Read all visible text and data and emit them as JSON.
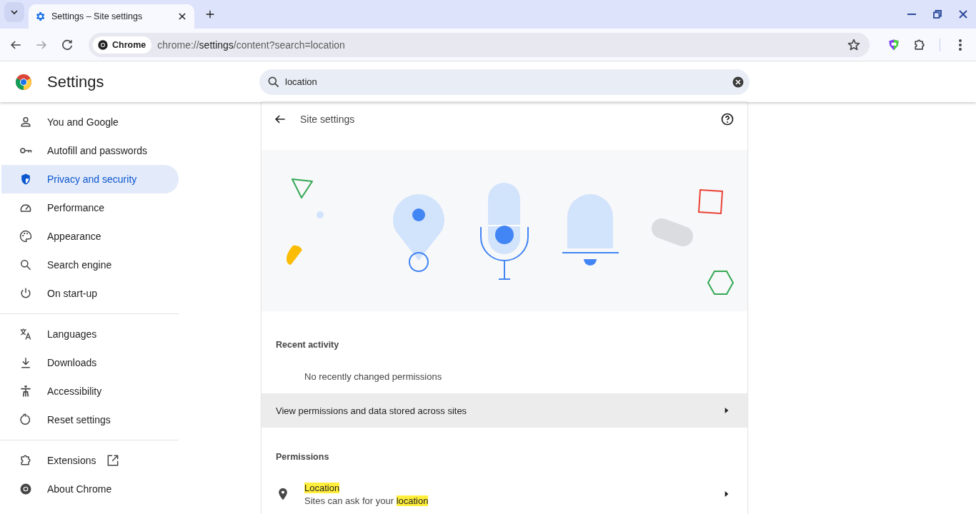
{
  "tab_strip": {
    "tabs": [
      {
        "title": "Settings – Site settings",
        "selected": true
      }
    ]
  },
  "toolbar": {
    "chip": "Chrome",
    "url": {
      "scheme": "chrome://",
      "host": "settings",
      "path": "/content?search=location"
    }
  },
  "header": {
    "title": "Settings",
    "search": {
      "value": "location"
    }
  },
  "sidebar": {
    "groups": [
      {
        "items": [
          {
            "label": "You and Google",
            "selected": false
          },
          {
            "label": "Autofill and passwords",
            "selected": false
          },
          {
            "label": "Privacy and security",
            "selected": true
          },
          {
            "label": "Performance",
            "selected": false
          },
          {
            "label": "Appearance",
            "selected": false
          },
          {
            "label": "Search engine",
            "selected": false
          },
          {
            "label": "On start-up",
            "selected": false
          }
        ]
      },
      {
        "items": [
          {
            "label": "Languages",
            "selected": false
          },
          {
            "label": "Downloads",
            "selected": false
          },
          {
            "label": "Accessibility",
            "selected": false
          },
          {
            "label": "Reset settings",
            "selected": false
          }
        ]
      },
      {
        "items": [
          {
            "label": "Extensions",
            "selected": false,
            "external": true
          },
          {
            "label": "About Chrome",
            "selected": false
          }
        ]
      }
    ]
  },
  "page": {
    "title": "Site settings",
    "recent_activity": {
      "heading": "Recent activity",
      "empty": "No recently changed permissions"
    },
    "link_row": {
      "label": "View permissions and data stored across sites",
      "hovered": true
    },
    "permissions": {
      "heading": "Permissions",
      "items": [
        {
          "title": "Location",
          "title_highlighted": true,
          "description": [
            {
              "text": "Sites can ask for your ",
              "highlight": false
            },
            {
              "text": "location",
              "highlight": true
            }
          ]
        }
      ]
    }
  }
}
